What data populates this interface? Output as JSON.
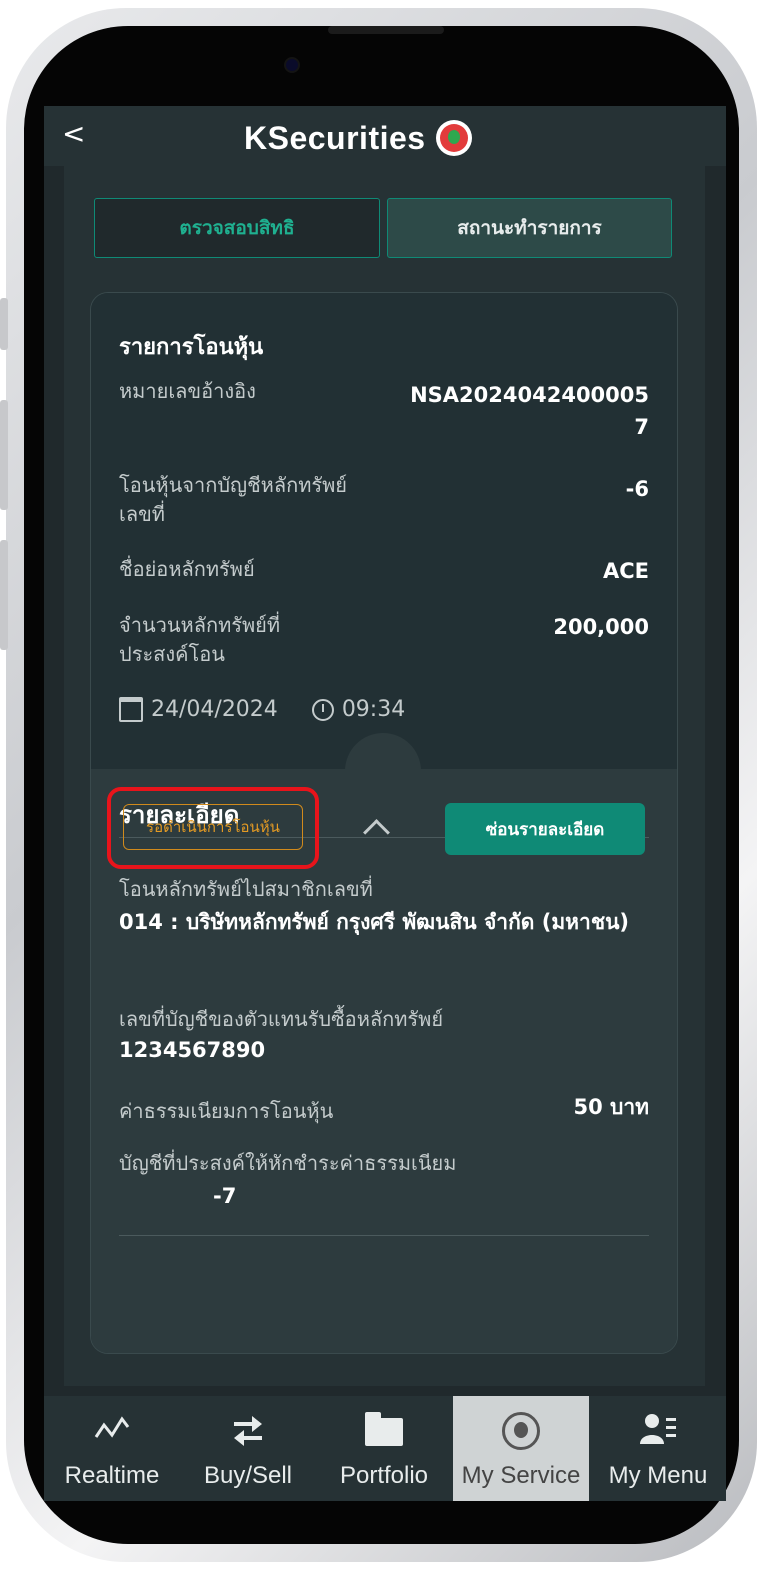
{
  "header": {
    "back_glyph": "<",
    "logo_text": "KSecurities"
  },
  "tabs": [
    {
      "label": "ตรวจสอบสิทธิ"
    },
    {
      "label": "สถานะทำรายการ"
    }
  ],
  "card": {
    "title": "รายการโอนหุ้น",
    "rows": [
      {
        "label": "หมายเลขอ้างอิง",
        "value": "NSA2024042400005\n7"
      },
      {
        "label": "โอนหุ้นจากบัญชีหลักทรัพย์\nเลขที่",
        "value": "-6"
      },
      {
        "label": "ชื่อย่อหลักทรัพย์",
        "value": "ACE"
      },
      {
        "label": "จำนวนหลักทรัพย์ที่\nประสงค์โอน",
        "value": "200,000"
      }
    ],
    "date": "24/04/2024",
    "time": "09:34"
  },
  "details": {
    "title": "รายละเอียด",
    "member_label": "โอนหลักทรัพย์ไปสมาชิกเลขที่",
    "member_value": "014 : บริษัทหลักทรัพย์ กรุงศรี พัฒนสิน จำกัด (มหาชน)",
    "agent_label": "เลขที่บัญชีของตัวแทนรับซื้อหลักทรัพย์",
    "agent_value": "1234567890",
    "fee_label": "ค่าธรรมเนียมการโอนหุ้น",
    "fee_value": "50 บาท",
    "fee_account_label": "บัญชีที่ประสงค์ให้หักชำระค่าธรรมเนียม",
    "fee_account_value": "-7"
  },
  "footer": {
    "status": "รอดำเนินการโอนหุ้น",
    "hide_button": "ซ่อนรายละเอียด"
  },
  "nav": [
    {
      "label": "Realtime",
      "icon": "realtime-chart-icon"
    },
    {
      "label": "Buy/Sell",
      "icon": "buy-sell-arrows-icon"
    },
    {
      "label": "Portfolio",
      "icon": "folder-icon"
    },
    {
      "label": "My Service",
      "icon": "kbank-logo-icon",
      "active": true
    },
    {
      "label": "My Menu",
      "icon": "user-menu-icon"
    }
  ],
  "colors": {
    "accent": "#0f8a76",
    "background": "#20292c",
    "status_orange": "#e39a24",
    "highlight_red": "#e8141b"
  }
}
